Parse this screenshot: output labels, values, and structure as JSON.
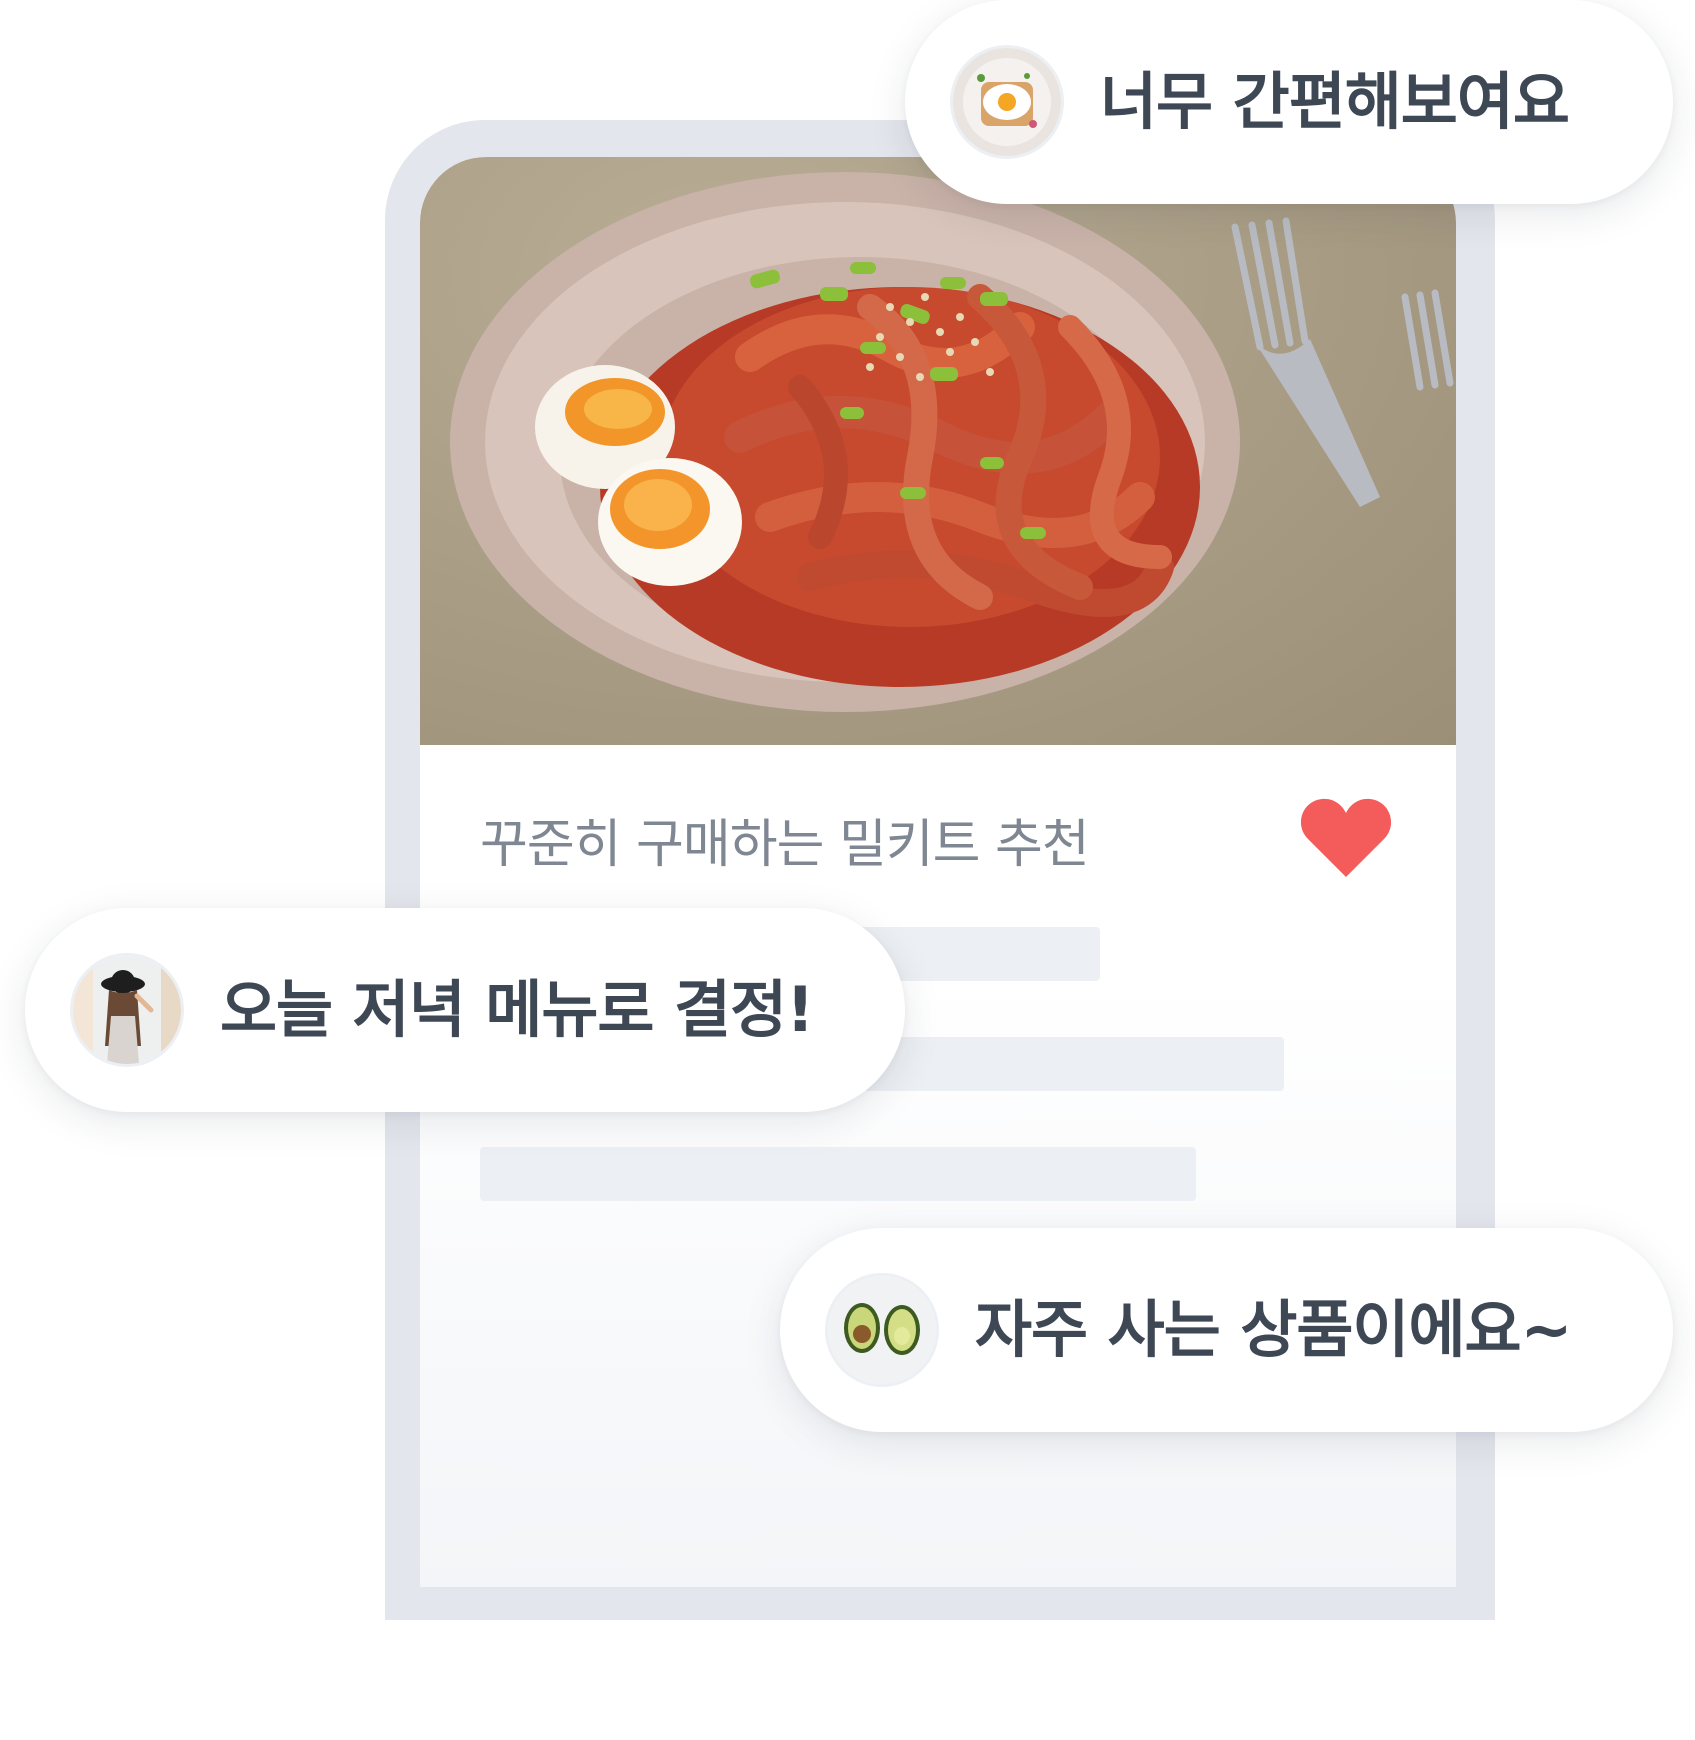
{
  "card": {
    "title": "꾸준히 구매하는 밀키트 추천",
    "photo_alt": "food-photo",
    "heart_color": "#f45b5b"
  },
  "comments": [
    {
      "text": "너무 간편해보여요",
      "avatar": "fried-egg-toast-avatar"
    },
    {
      "text": "오늘 저녁 메뉴로 결정!",
      "avatar": "woman-in-hat-avatar"
    },
    {
      "text": "자주 사는 상품이에요~",
      "avatar": "avocado-avatar"
    }
  ],
  "colors": {
    "frame": "#e3e6ec",
    "skeleton": "#eceff3",
    "title_text": "#7f8793",
    "bubble_text": "#3e4754"
  }
}
